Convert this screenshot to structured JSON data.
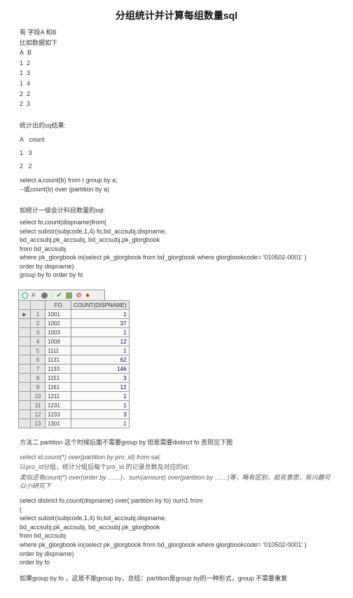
{
  "title": "分组统计并计算每组数量sql",
  "intro": {
    "l1": "有 字段A 和B",
    "l2": "比如数据如下",
    "h_a": "A",
    "h_b": "B",
    "r1a": "1",
    "r1b": "2",
    "r2a": "1",
    "r2b": "3",
    "r3a": "1",
    "r3b": "4",
    "r4a": "2",
    "r4b": "2",
    "r5a": "2",
    "r5b": "3"
  },
  "res1": {
    "title": "统计出的sq结果:",
    "h_a": "A",
    "h_c": "count",
    "r1a": "1",
    "r1c": "3",
    "r2a": "2",
    "r2c": "2"
  },
  "sql1": {
    "l1": "select a,count(b) from t group by a;",
    "l2": "--或count(b) over (partition by a)"
  },
  "sec2title": "如统计一级会计科目数量的sql:",
  "sql2": {
    "l1": "select fo,count(dispname)from(",
    "l2": "select substr(subjcode,1,4) fo,bd_accsubj.dispname,",
    "l3": "bd_accsubj.pk_accsubj, bd_accsubj.pk_glorgbook",
    "l4": "from bd_accsubj",
    "l5": "where pk_glorgbook in(select pk_glorgbook from bd_glorgbook where glorgbookcode= '010502-0001' )",
    "l6": "order by dispname)",
    "l7": "group by fo  order by fo"
  },
  "table": {
    "h_blank": "",
    "h_arrow": "",
    "h_fo": "FO",
    "h_cnt": "COUNT(DISPNAME)",
    "rows": [
      {
        "n": "1",
        "arrow": "►",
        "fo": "1001",
        "cnt": "1"
      },
      {
        "n": "2",
        "arrow": "",
        "fo": "1002",
        "cnt": "37"
      },
      {
        "n": "3",
        "arrow": "",
        "fo": "1003",
        "cnt": "1"
      },
      {
        "n": "4",
        "arrow": "",
        "fo": "1009",
        "cnt": "12"
      },
      {
        "n": "5",
        "arrow": "",
        "fo": "1111",
        "cnt": "1"
      },
      {
        "n": "6",
        "arrow": "",
        "fo": "1131",
        "cnt": "62"
      },
      {
        "n": "7",
        "arrow": "",
        "fo": "1133",
        "cnt": "146"
      },
      {
        "n": "8",
        "arrow": "",
        "fo": "1151",
        "cnt": "3"
      },
      {
        "n": "9",
        "arrow": "",
        "fo": "1161",
        "cnt": "12"
      },
      {
        "n": "10",
        "arrow": "",
        "fo": "1211",
        "cnt": "1"
      },
      {
        "n": "11",
        "arrow": "",
        "fo": "1231",
        "cnt": "1"
      },
      {
        "n": "12",
        "arrow": "",
        "fo": "1233",
        "cnt": "3"
      },
      {
        "n": "13",
        "arrow": "",
        "fo": "1301",
        "cnt": "1"
      }
    ]
  },
  "method2": {
    "intro": "方法二 partition 这个时候后面不需要group by 但是需要distinct fo 否则见下图",
    "eg1": "select id,count(*) over(partition by pro_id) from sal;",
    "eg2": "以pro_id分组，统计分组后每个pro_id 的记录总数及对应的id;",
    "eg3": "类似还有count(*) over(order by ……)、sum(amount) over(partition by ……)等，略有区别，挺有意思，有兴趣可以小研究下"
  },
  "sql3": {
    "l1": "select distinct fo,count(dispname) over( partition by fo) num1 from",
    "l2": "(",
    "l3": "select substr(subjcode,1,4) fo,bd_accsubj.dispname,",
    "l4": "bd_accsubj.pk_accsubj, bd_accsubj.pk_glorgbook",
    "l5": "from bd_accsubj",
    "l6": "where pk_glorgbook in(select pk_glorgbook from bd_glorgbook where glorgbookcode= '010502-0001' )",
    "l7": "order by dispname)",
    "l8": "order by fo"
  },
  "footer": "如果group by fo ，这是不能group by，总结：partition是group by的一种形式，group 不需要重复"
}
